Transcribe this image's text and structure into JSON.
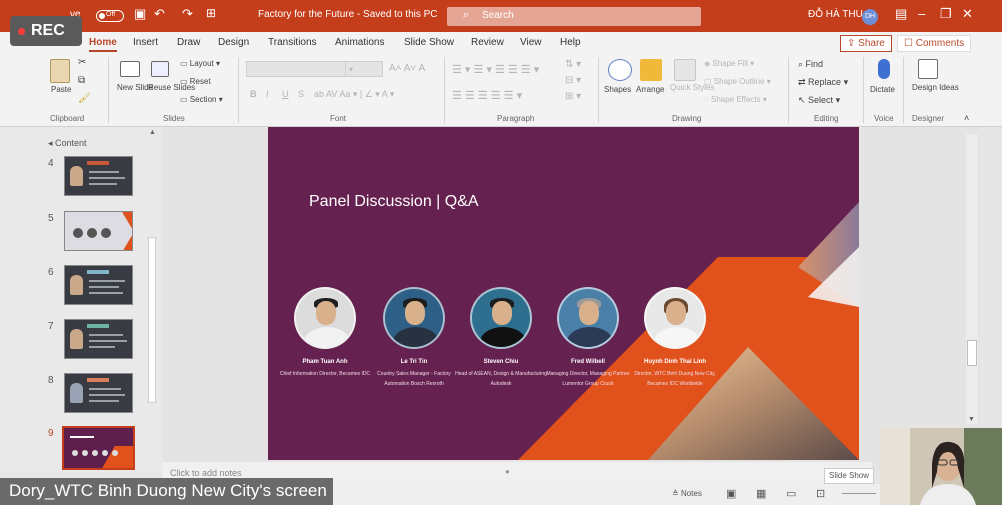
{
  "app": {
    "autosave_label": "ve",
    "autosave_state": "Off",
    "doc_title": "Factory for the Future - Saved to this PC",
    "search_placeholder": "Search",
    "user_name": "ĐỖ HÀ THU",
    "user_initials": "DH",
    "accent": "#c43e1c"
  },
  "recording": {
    "label": "REC"
  },
  "tabs": [
    "Home",
    "Insert",
    "Draw",
    "Design",
    "Transitions",
    "Animations",
    "Slide Show",
    "Review",
    "View",
    "Help"
  ],
  "active_tab": "Home",
  "actions": {
    "share": "Share",
    "comments": "Comments"
  },
  "ribbon": {
    "clipboard": {
      "paste": "Paste",
      "group": "Clipboard"
    },
    "slides": {
      "new_slide": "New Slide",
      "reuse_slides": "Reuse Slides",
      "layout": "Layout",
      "reset": "Reset",
      "section": "Section",
      "group": "Slides"
    },
    "font": {
      "bold": "B",
      "italic": "I",
      "underline": "U",
      "strike": "S",
      "group": "Font"
    },
    "paragraph": {
      "group": "Paragraph"
    },
    "drawing": {
      "shapes": "Shapes",
      "arrange": "Arrange",
      "quick_styles": "Quick Styles",
      "shape_fill": "Shape Fill",
      "shape_outline": "Shape Outline",
      "shape_effects": "Shape Effects",
      "group": "Drawing"
    },
    "editing": {
      "find": "Find",
      "replace": "Replace",
      "select": "Select",
      "group": "Editing"
    },
    "voice": {
      "dictate": "Dictate",
      "group": "Voice"
    },
    "designer": {
      "design_ideas": "Design Ideas",
      "group": "Designer"
    }
  },
  "outline": {
    "section": "Content",
    "slide_numbers": [
      "4",
      "5",
      "6",
      "7",
      "8",
      "9"
    ],
    "selected": "9"
  },
  "slide": {
    "title": "Panel Discussion | Q&A",
    "background_color": "#65214f",
    "shape_color": "#e0511b",
    "panelists": [
      {
        "name": "Pham Tuan Anh",
        "role": "Chief Information Director, Becamex IDC"
      },
      {
        "name": "Le Tri Tin",
        "role": "Country Sales Manager - Factory Automation Bosch Rexroth"
      },
      {
        "name": "Steven Chiu",
        "role": "Head of ASEAN, Design & Manufacturing Autodesk"
      },
      {
        "name": "Fred Wilbell",
        "role": "Managing Director, Managing Partner Lumentor Group Crush"
      },
      {
        "name": "Huynh Dinh Thai Linh",
        "role": "Director, WTC Binh Duong New City, Becamex IDC Worldwide"
      }
    ]
  },
  "notes": {
    "placeholder": "Click to add notes"
  },
  "status": {
    "notes_label": "Notes",
    "slideshow_label": "Slide Show"
  },
  "screen_share_label": "Dory_WTC Binh Duong New City's screen"
}
